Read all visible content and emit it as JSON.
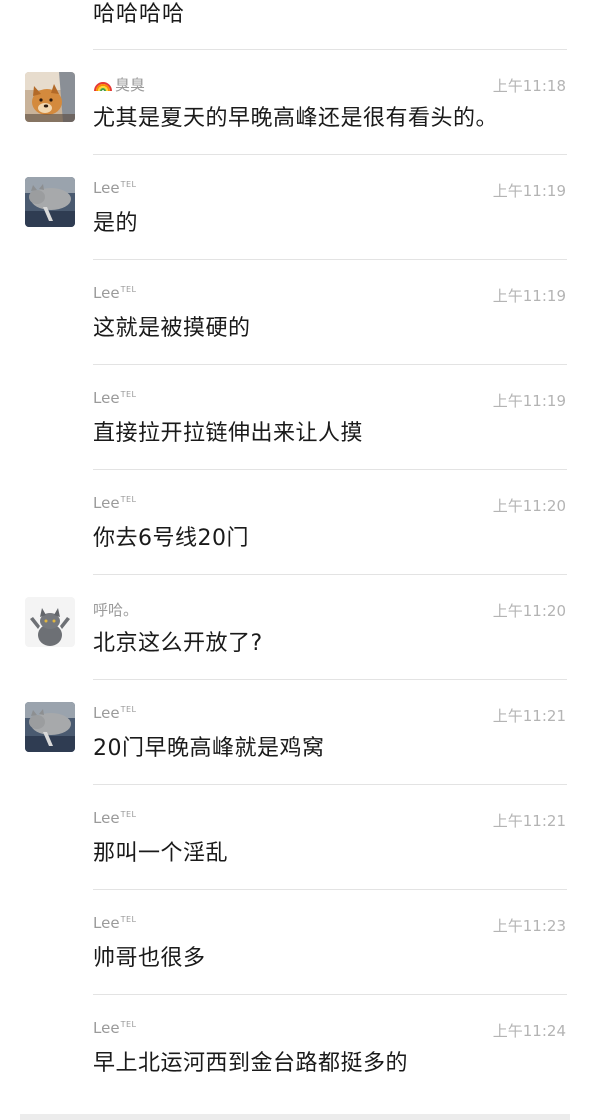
{
  "chat": {
    "partial_top_text": "哈哈哈哈",
    "messages": [
      {
        "sender": "臭臭",
        "sender_badge": "",
        "time": "上午11:18",
        "text": "尤其是夏天的早晚高峰还是很有看头的。",
        "avatar": "dog-avatar",
        "show_avatar": true,
        "rainbow_prefix": true
      },
      {
        "sender": "Lee",
        "sender_badge": "TEL",
        "time": "上午11:19",
        "text": "是的",
        "avatar": "cat-couch-avatar",
        "show_avatar": true
      },
      {
        "sender": "Lee",
        "sender_badge": "TEL",
        "time": "上午11:19",
        "text": "这就是被摸硬的",
        "show_avatar": false
      },
      {
        "sender": "Lee",
        "sender_badge": "TEL",
        "time": "上午11:19",
        "text": "直接拉开拉链伸出来让人摸",
        "show_avatar": false
      },
      {
        "sender": "Lee",
        "sender_badge": "TEL",
        "time": "上午11:20",
        "text": "你去6号线20门",
        "show_avatar": false
      },
      {
        "sender": "呼哈。",
        "sender_badge": "",
        "time": "上午11:20",
        "text": "北京这么开放了?",
        "avatar": "grey-cat-avatar",
        "show_avatar": true
      },
      {
        "sender": "Lee",
        "sender_badge": "TEL",
        "time": "上午11:21",
        "text": "20门早晚高峰就是鸡窝",
        "avatar": "cat-couch-avatar",
        "show_avatar": true
      },
      {
        "sender": "Lee",
        "sender_badge": "TEL",
        "time": "上午11:21",
        "text": "那叫一个淫乱",
        "show_avatar": false
      },
      {
        "sender": "Lee",
        "sender_badge": "TEL",
        "time": "上午11:23",
        "text": "帅哥也很多",
        "show_avatar": false
      },
      {
        "sender": "Lee",
        "sender_badge": "TEL",
        "time": "上午11:24",
        "text": "早上北运河西到金台路都挺多的",
        "show_avatar": false
      }
    ]
  },
  "colors": {
    "background": "#ffffff",
    "message_text": "#1a1a1a",
    "sender_text": "#9a9a9a",
    "time_text": "#b4b4b4",
    "divider": "#e3e3e3"
  }
}
